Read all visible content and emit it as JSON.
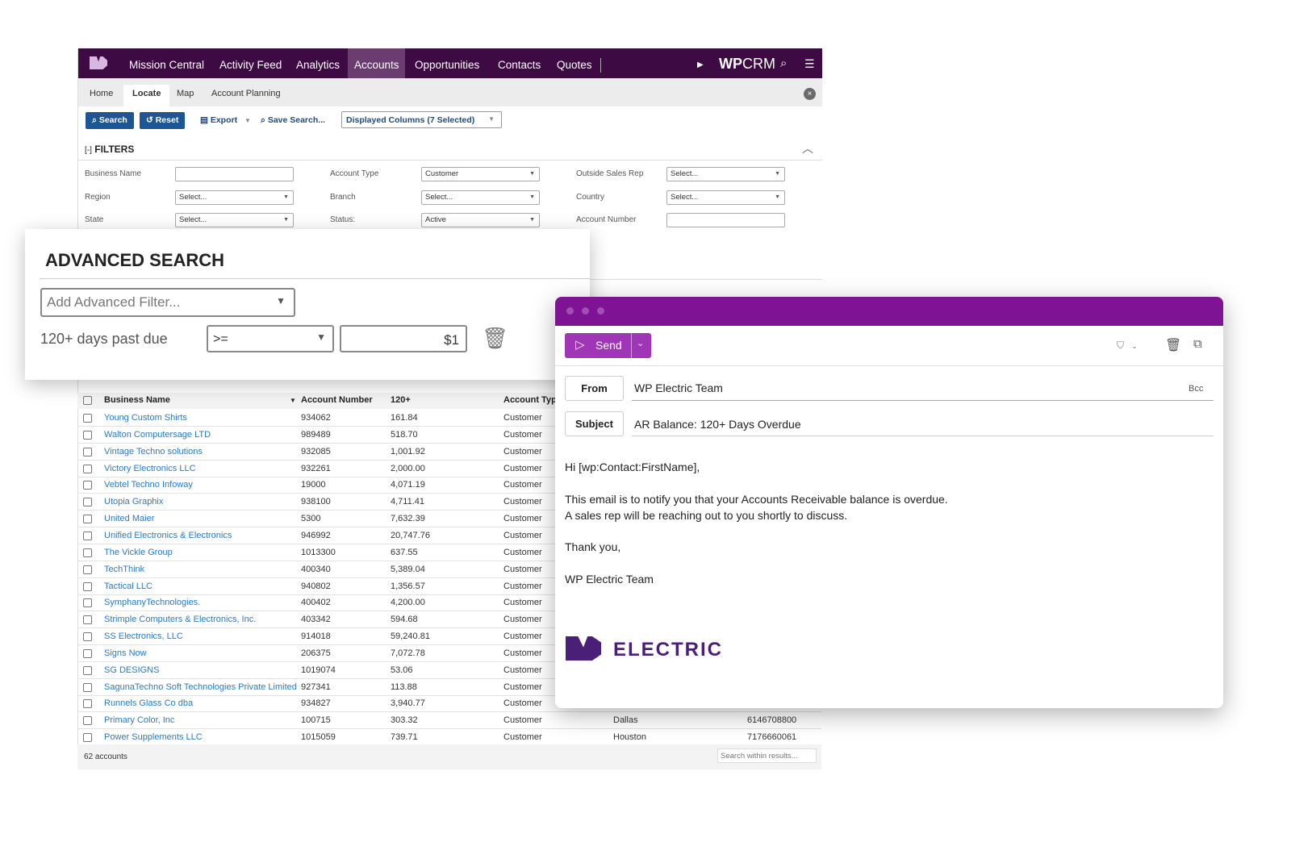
{
  "nav": {
    "items": [
      "Mission Central",
      "Activity Feed",
      "Analytics",
      "Accounts",
      "Opportunities",
      "Contacts",
      "Quotes"
    ],
    "active": "Accounts",
    "brand_bold": "WP",
    "brand_light": "CRM",
    "colors": {
      "nav": "#3d0a44",
      "active": "#6a3c70"
    }
  },
  "subnav": {
    "items": [
      "Home",
      "Locate",
      "Map",
      "Account Planning"
    ],
    "active": "Locate"
  },
  "toolbar": {
    "search": "Search",
    "reset": "Reset",
    "export": "Export",
    "save_search": "Save Search...",
    "displayed_columns": "Displayed Columns (7 Selected)"
  },
  "filters": {
    "title": "FILTERS",
    "toggle": "[-]",
    "fields": [
      {
        "label": "Business Name",
        "value": ""
      },
      {
        "label": "Account Type",
        "value": "Customer"
      },
      {
        "label": "Outside Sales Rep",
        "value": "Select..."
      },
      {
        "label": "Region",
        "value": "Select..."
      },
      {
        "label": "Branch",
        "value": "Select..."
      },
      {
        "label": "Country",
        "value": "Select..."
      },
      {
        "label": "State",
        "value": "Select..."
      },
      {
        "label": "Status:",
        "value": "Active"
      },
      {
        "label": "Account Number",
        "value": ""
      }
    ]
  },
  "advanced": {
    "title": "ADVANCED SEARCH",
    "add_filter_placeholder": "Add Advanced Filter...",
    "filter_label": "120+ days past due",
    "operator": ">=",
    "value": "$1"
  },
  "table": {
    "headers": [
      "Business Name",
      "Account Number",
      "120+",
      "Account Type"
    ],
    "rows": [
      {
        "name": "Young Custom Shirts",
        "number": "934062",
        "amount": "161.84",
        "type": "Customer"
      },
      {
        "name": "Walton Computersage LTD",
        "number": "989489",
        "amount": "518.70",
        "type": "Customer"
      },
      {
        "name": "Vintage Techno solutions",
        "number": "932085",
        "amount": "1,001.92",
        "type": "Customer"
      },
      {
        "name": "Victory Electronics LLC",
        "number": "932261",
        "amount": "2,000.00",
        "type": "Customer"
      },
      {
        "name": "Vebtel  Techno Infoway",
        "number": "19000",
        "amount": "4,071.19",
        "type": "Customer"
      },
      {
        "name": "Utopia Graphix",
        "number": "938100",
        "amount": "4,711.41",
        "type": "Customer"
      },
      {
        "name": "United Maier",
        "number": "5300",
        "amount": "7,632.39",
        "type": "Customer"
      },
      {
        "name": "Unified Electronics & Electronics",
        "number": "946992",
        "amount": "20,747.76",
        "type": "Customer"
      },
      {
        "name": "The Vickle Group",
        "number": "1013300",
        "amount": "637.55",
        "type": "Customer"
      },
      {
        "name": "TechThink",
        "number": "400340",
        "amount": "5,389.04",
        "type": "Customer"
      },
      {
        "name": "Tactical LLC",
        "number": "940802",
        "amount": "1,356.57",
        "type": "Customer"
      },
      {
        "name": "SymphanyTechnologies.",
        "number": "400402",
        "amount": "4,200.00",
        "type": "Customer"
      },
      {
        "name": "Strimple Computers & Electronics, Inc.",
        "number": "403342",
        "amount": "594.68",
        "type": "Customer"
      },
      {
        "name": "SS Electronics, LLC",
        "number": "914018",
        "amount": "59,240.81",
        "type": "Customer"
      },
      {
        "name": "Signs Now",
        "number": "206375",
        "amount": "7,072.78",
        "type": "Customer"
      },
      {
        "name": "SG DESIGNS",
        "number": "1019074",
        "amount": "53.06",
        "type": "Customer"
      },
      {
        "name": "SagunaTechno Soft Technologies Private Limited",
        "number": "927341",
        "amount": "113.88",
        "type": "Customer"
      },
      {
        "name": "Runnels Glass Co dba",
        "number": "934827",
        "amount": "3,940.77",
        "type": "Customer"
      },
      {
        "name": "Primary Color, Inc",
        "number": "100715",
        "amount": "303.32",
        "type": "Customer",
        "city": "Dallas",
        "phone": "6146708800"
      },
      {
        "name": "Power Supplements LLC",
        "number": "1015059",
        "amount": "739.71",
        "type": "Customer",
        "city": "Houston",
        "phone": "7176660061"
      }
    ],
    "count": "62 accounts",
    "search_placeholder": "Search within results..."
  },
  "email": {
    "send": "Send",
    "from_label": "From",
    "from_value": "WP Electric Team",
    "bcc": "Bcc",
    "subject_label": "Subject",
    "subject_value": "AR Balance: 120+ Days Overdue",
    "body": [
      "Hi [wp:Contact:FirstName],",
      "This email is to notify you that your Accounts Receivable balance is overdue.",
      "A sales rep will be reaching out to you shortly to discuss.",
      "Thank you,",
      "WP Electric Team"
    ],
    "logo_text": "ELECTRIC",
    "colors": {
      "titlebar": "#7e1394",
      "send": "#a035b8",
      "logo": "#4a1f78"
    }
  }
}
